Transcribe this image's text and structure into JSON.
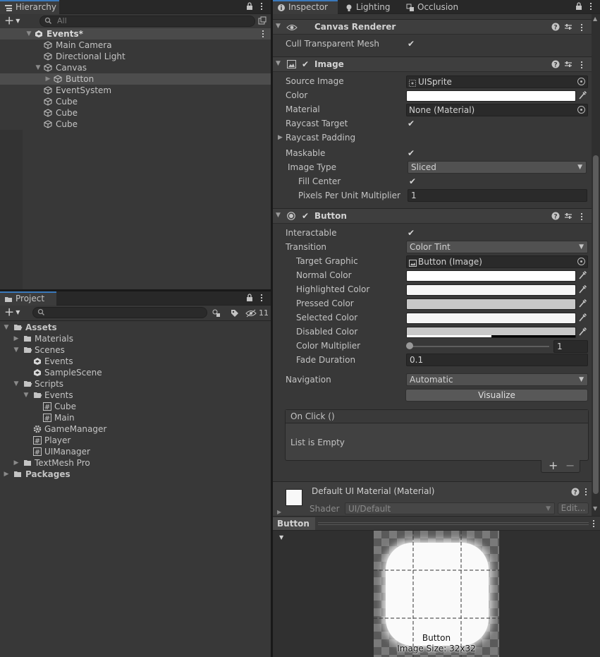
{
  "hierarchy": {
    "tab_label": "Hierarchy",
    "search_placeholder": "All",
    "scene_name": "Events*",
    "items": [
      {
        "label": "Main Camera",
        "indent": 2
      },
      {
        "label": "Directional Light",
        "indent": 2
      },
      {
        "label": "Canvas",
        "indent": 2
      },
      {
        "label": "Button",
        "indent": 3
      },
      {
        "label": "EventSystem",
        "indent": 2
      },
      {
        "label": "Cube",
        "indent": 2
      },
      {
        "label": "Cube",
        "indent": 2
      },
      {
        "label": "Cube",
        "indent": 2
      }
    ]
  },
  "project": {
    "tab_label": "Project",
    "hidden_count": "11",
    "tree": [
      {
        "label": "Assets",
        "icon": "folder-open-icon",
        "bold": true
      },
      {
        "label": "Materials",
        "icon": "folder-icon"
      },
      {
        "label": "Scenes",
        "icon": "folder-open-icon"
      },
      {
        "label": "Events",
        "icon": "unity-scene-icon"
      },
      {
        "label": "SampleScene",
        "icon": "unity-scene-icon"
      },
      {
        "label": "Scripts",
        "icon": "folder-open-icon"
      },
      {
        "label": "Events",
        "icon": "folder-open-icon"
      },
      {
        "label": "Cube",
        "icon": "script-icon"
      },
      {
        "label": "Main",
        "icon": "script-icon"
      },
      {
        "label": "GameManager",
        "icon": "gear-icon"
      },
      {
        "label": "Player",
        "icon": "script-icon"
      },
      {
        "label": "UIManager",
        "icon": "script-icon"
      },
      {
        "label": "TextMesh Pro",
        "icon": "folder-icon"
      },
      {
        "label": "Packages",
        "icon": "folder-icon",
        "bold": true
      }
    ]
  },
  "inspector": {
    "tabs": {
      "inspector": "Inspector",
      "lighting": "Lighting",
      "occlusion": "Occlusion"
    },
    "canvas_renderer": {
      "title": "Canvas Renderer",
      "cull_label": "Cull Transparent Mesh"
    },
    "image": {
      "title": "Image",
      "source_image_label": "Source Image",
      "source_image_value": "UISprite",
      "color_label": "Color",
      "material_label": "Material",
      "material_value": "None (Material)",
      "raycast_target_label": "Raycast Target",
      "raycast_padding_label": "Raycast Padding",
      "maskable_label": "Maskable",
      "image_type_label": "Image Type",
      "image_type_value": "Sliced",
      "fill_center_label": "Fill Center",
      "ppu_label": "Pixels Per Unit Multiplier",
      "ppu_value": "1"
    },
    "button": {
      "title": "Button",
      "interactable_label": "Interactable",
      "transition_label": "Transition",
      "transition_value": "Color Tint",
      "target_graphic_label": "Target Graphic",
      "target_graphic_value": "Button (Image)",
      "normal_label": "Normal Color",
      "highlighted_label": "Highlighted Color",
      "pressed_label": "Pressed Color",
      "selected_label": "Selected Color",
      "disabled_label": "Disabled Color",
      "multiplier_label": "Color Multiplier",
      "multiplier_value": "1",
      "fade_label": "Fade Duration",
      "fade_value": "0.1",
      "navigation_label": "Navigation",
      "navigation_value": "Automatic",
      "visualize_label": "Visualize",
      "onclick_label": "On Click ()",
      "list_empty": "List is Empty"
    },
    "material": {
      "title": "Default UI Material (Material)",
      "shader_label": "Shader",
      "shader_value": "UI/Default",
      "edit_label": "Edit..."
    },
    "colors": {
      "normal": "#ffffff",
      "highlighted": "#f5f5f5",
      "pressed": "#c8c8c8",
      "selected": "#f5f5f5",
      "disabled": "#c8c8c8"
    }
  },
  "preview": {
    "title": "Button",
    "caption_name": "Button",
    "caption_size": "Image Size: 32x32"
  }
}
